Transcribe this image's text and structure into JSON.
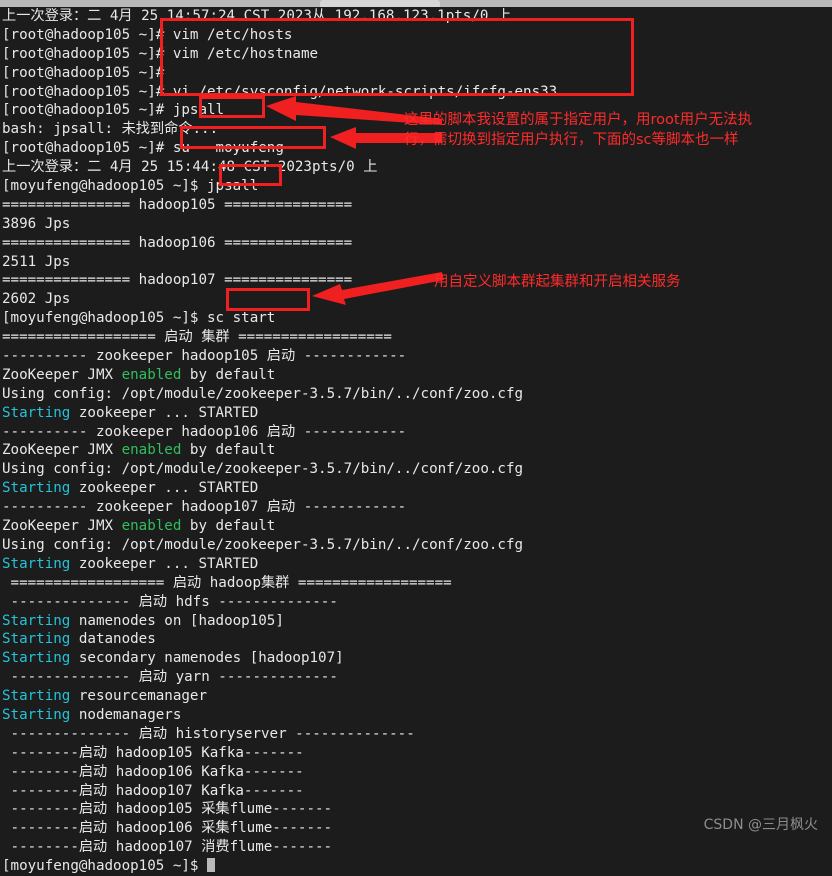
{
  "window": {
    "titlebar_label": ""
  },
  "terminal": {
    "lines": [
      {
        "id": "l01",
        "text": "上一次登录：二 4月 25 14:57:24 CST 2023从 192.168.123.1pts/0 上"
      },
      {
        "id": "l02",
        "text": "[root@hadoop105 ~]# vim /etc/hosts"
      },
      {
        "id": "l03",
        "text": "[root@hadoop105 ~]# vim /etc/hostname"
      },
      {
        "id": "l04",
        "text": "[root@hadoop105 ~]# "
      },
      {
        "id": "l05",
        "text": "[root@hadoop105 ~]# vi /etc/sysconfig/network-scripts/ifcfg-ens33"
      },
      {
        "id": "l06",
        "text": "[root@hadoop105 ~]# jpsall"
      },
      {
        "id": "l07",
        "text": "bash: jpsall: 未找到命令..."
      },
      {
        "id": "l08",
        "text": "[root@hadoop105 ~]# su - moyufeng"
      },
      {
        "id": "l09",
        "text": "上一次登录：二 4月 25 15:44:48 CST 2023pts/0 上"
      },
      {
        "id": "l10",
        "text": "[moyufeng@hadoop105 ~]$ jpsall"
      },
      {
        "id": "l11",
        "text": "=============== hadoop105 ==============="
      },
      {
        "id": "l12",
        "text": "3896 Jps"
      },
      {
        "id": "l13",
        "text": "=============== hadoop106 ==============="
      },
      {
        "id": "l14",
        "text": "2511 Jps"
      },
      {
        "id": "l15",
        "text": "=============== hadoop107 ==============="
      },
      {
        "id": "l16",
        "text": "2602 Jps"
      },
      {
        "id": "l17",
        "text": "[moyufeng@hadoop105 ~]$ sc start"
      },
      {
        "id": "l18",
        "text": "================== 启动 集群 =================="
      },
      {
        "id": "l19",
        "text": "---------- zookeeper hadoop105 启动 ------------"
      },
      {
        "id": "l20",
        "pre": "ZooKeeper JMX ",
        "hi": "enabled",
        "post": " by default",
        "style": "green"
      },
      {
        "id": "l21",
        "text": "Using config: /opt/module/zookeeper-3.5.7/bin/../conf/zoo.cfg"
      },
      {
        "id": "l22",
        "pre": "",
        "hi": "Starting",
        "post": " zookeeper ... STARTED",
        "style": "cyan"
      },
      {
        "id": "l23",
        "text": "---------- zookeeper hadoop106 启动 ------------"
      },
      {
        "id": "l24",
        "pre": "ZooKeeper JMX ",
        "hi": "enabled",
        "post": " by default",
        "style": "green"
      },
      {
        "id": "l25",
        "text": "Using config: /opt/module/zookeeper-3.5.7/bin/../conf/zoo.cfg"
      },
      {
        "id": "l26",
        "pre": "",
        "hi": "Starting",
        "post": " zookeeper ... STARTED",
        "style": "cyan"
      },
      {
        "id": "l27",
        "text": "---------- zookeeper hadoop107 启动 ------------"
      },
      {
        "id": "l28",
        "pre": "ZooKeeper JMX ",
        "hi": "enabled",
        "post": " by default",
        "style": "green"
      },
      {
        "id": "l29",
        "text": "Using config: /opt/module/zookeeper-3.5.7/bin/../conf/zoo.cfg"
      },
      {
        "id": "l30",
        "pre": "",
        "hi": "Starting",
        "post": " zookeeper ... STARTED",
        "style": "cyan"
      },
      {
        "id": "l31",
        "text": " ================== 启动 hadoop集群 =================="
      },
      {
        "id": "l32",
        "text": " -------------- 启动 hdfs --------------"
      },
      {
        "id": "l33",
        "pre": "",
        "hi": "Starting",
        "post": " namenodes on [hadoop105]",
        "style": "cyan"
      },
      {
        "id": "l34",
        "pre": "",
        "hi": "Starting",
        "post": " datanodes",
        "style": "cyan"
      },
      {
        "id": "l35",
        "pre": "",
        "hi": "Starting",
        "post": " secondary namenodes [hadoop107]",
        "style": "cyan"
      },
      {
        "id": "l36",
        "text": " -------------- 启动 yarn --------------"
      },
      {
        "id": "l37",
        "pre": "",
        "hi": "Starting",
        "post": " resourcemanager",
        "style": "cyan"
      },
      {
        "id": "l38",
        "pre": "",
        "hi": "Starting",
        "post": " nodemanagers",
        "style": "cyan"
      },
      {
        "id": "l39",
        "text": " -------------- 启动 historyserver --------------"
      },
      {
        "id": "l40",
        "text": " --------启动 hadoop105 Kafka-------"
      },
      {
        "id": "l41",
        "text": " --------启动 hadoop106 Kafka-------"
      },
      {
        "id": "l42",
        "text": " --------启动 hadoop107 Kafka-------"
      },
      {
        "id": "l43",
        "text": " --------启动 hadoop105 采集flume-------"
      },
      {
        "id": "l44",
        "text": " --------启动 hadoop106 采集flume-------"
      },
      {
        "id": "l45",
        "text": " --------启动 hadoop107 消费flume-------"
      },
      {
        "id": "l46",
        "text": "[moyufeng@hadoop105 ~]$ "
      }
    ]
  },
  "annotations": {
    "color": "#f02020",
    "note_1_line_1": "这里的脚本我设置的属于指定用户，用root用户无法执",
    "note_1_line_2": "行，需切换到指定用户执行，下面的sc等脚本也一样",
    "note_2": "用自定义脚本群起集群和开启相关服务"
  },
  "watermark": {
    "text": "CSDN @三月枫火"
  }
}
